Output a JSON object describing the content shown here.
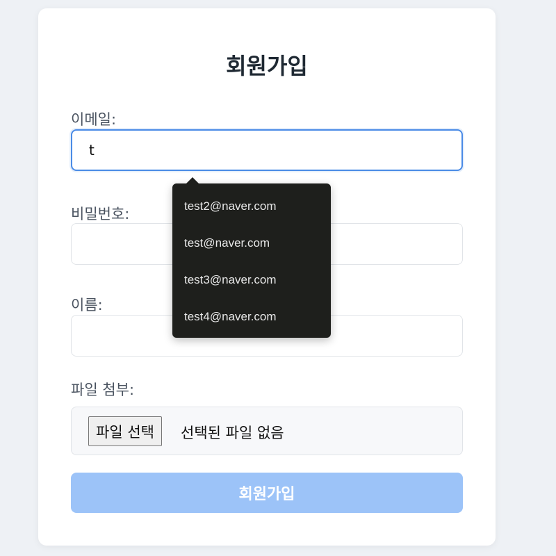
{
  "form": {
    "title": "회원가입",
    "email_label": "이메일:",
    "email_value": "t",
    "password_label": "비밀번호:",
    "password_value": "",
    "name_label": "이름:",
    "name_value": "",
    "file_label": "파일 첨부:",
    "file_button_label": "파일 선택",
    "file_status": "선택된 파일 없음",
    "submit_label": "회원가입",
    "submit_disabled": true
  },
  "autocomplete": {
    "items": [
      "test2@naver.com",
      "test@naver.com",
      "test3@naver.com",
      "test4@naver.com"
    ]
  },
  "colors": {
    "focus_border": "#4a8be6",
    "submit_bg": "#9cc3f8",
    "dropdown_bg": "#1e1f1c",
    "page_bg": "#eef1f5"
  }
}
